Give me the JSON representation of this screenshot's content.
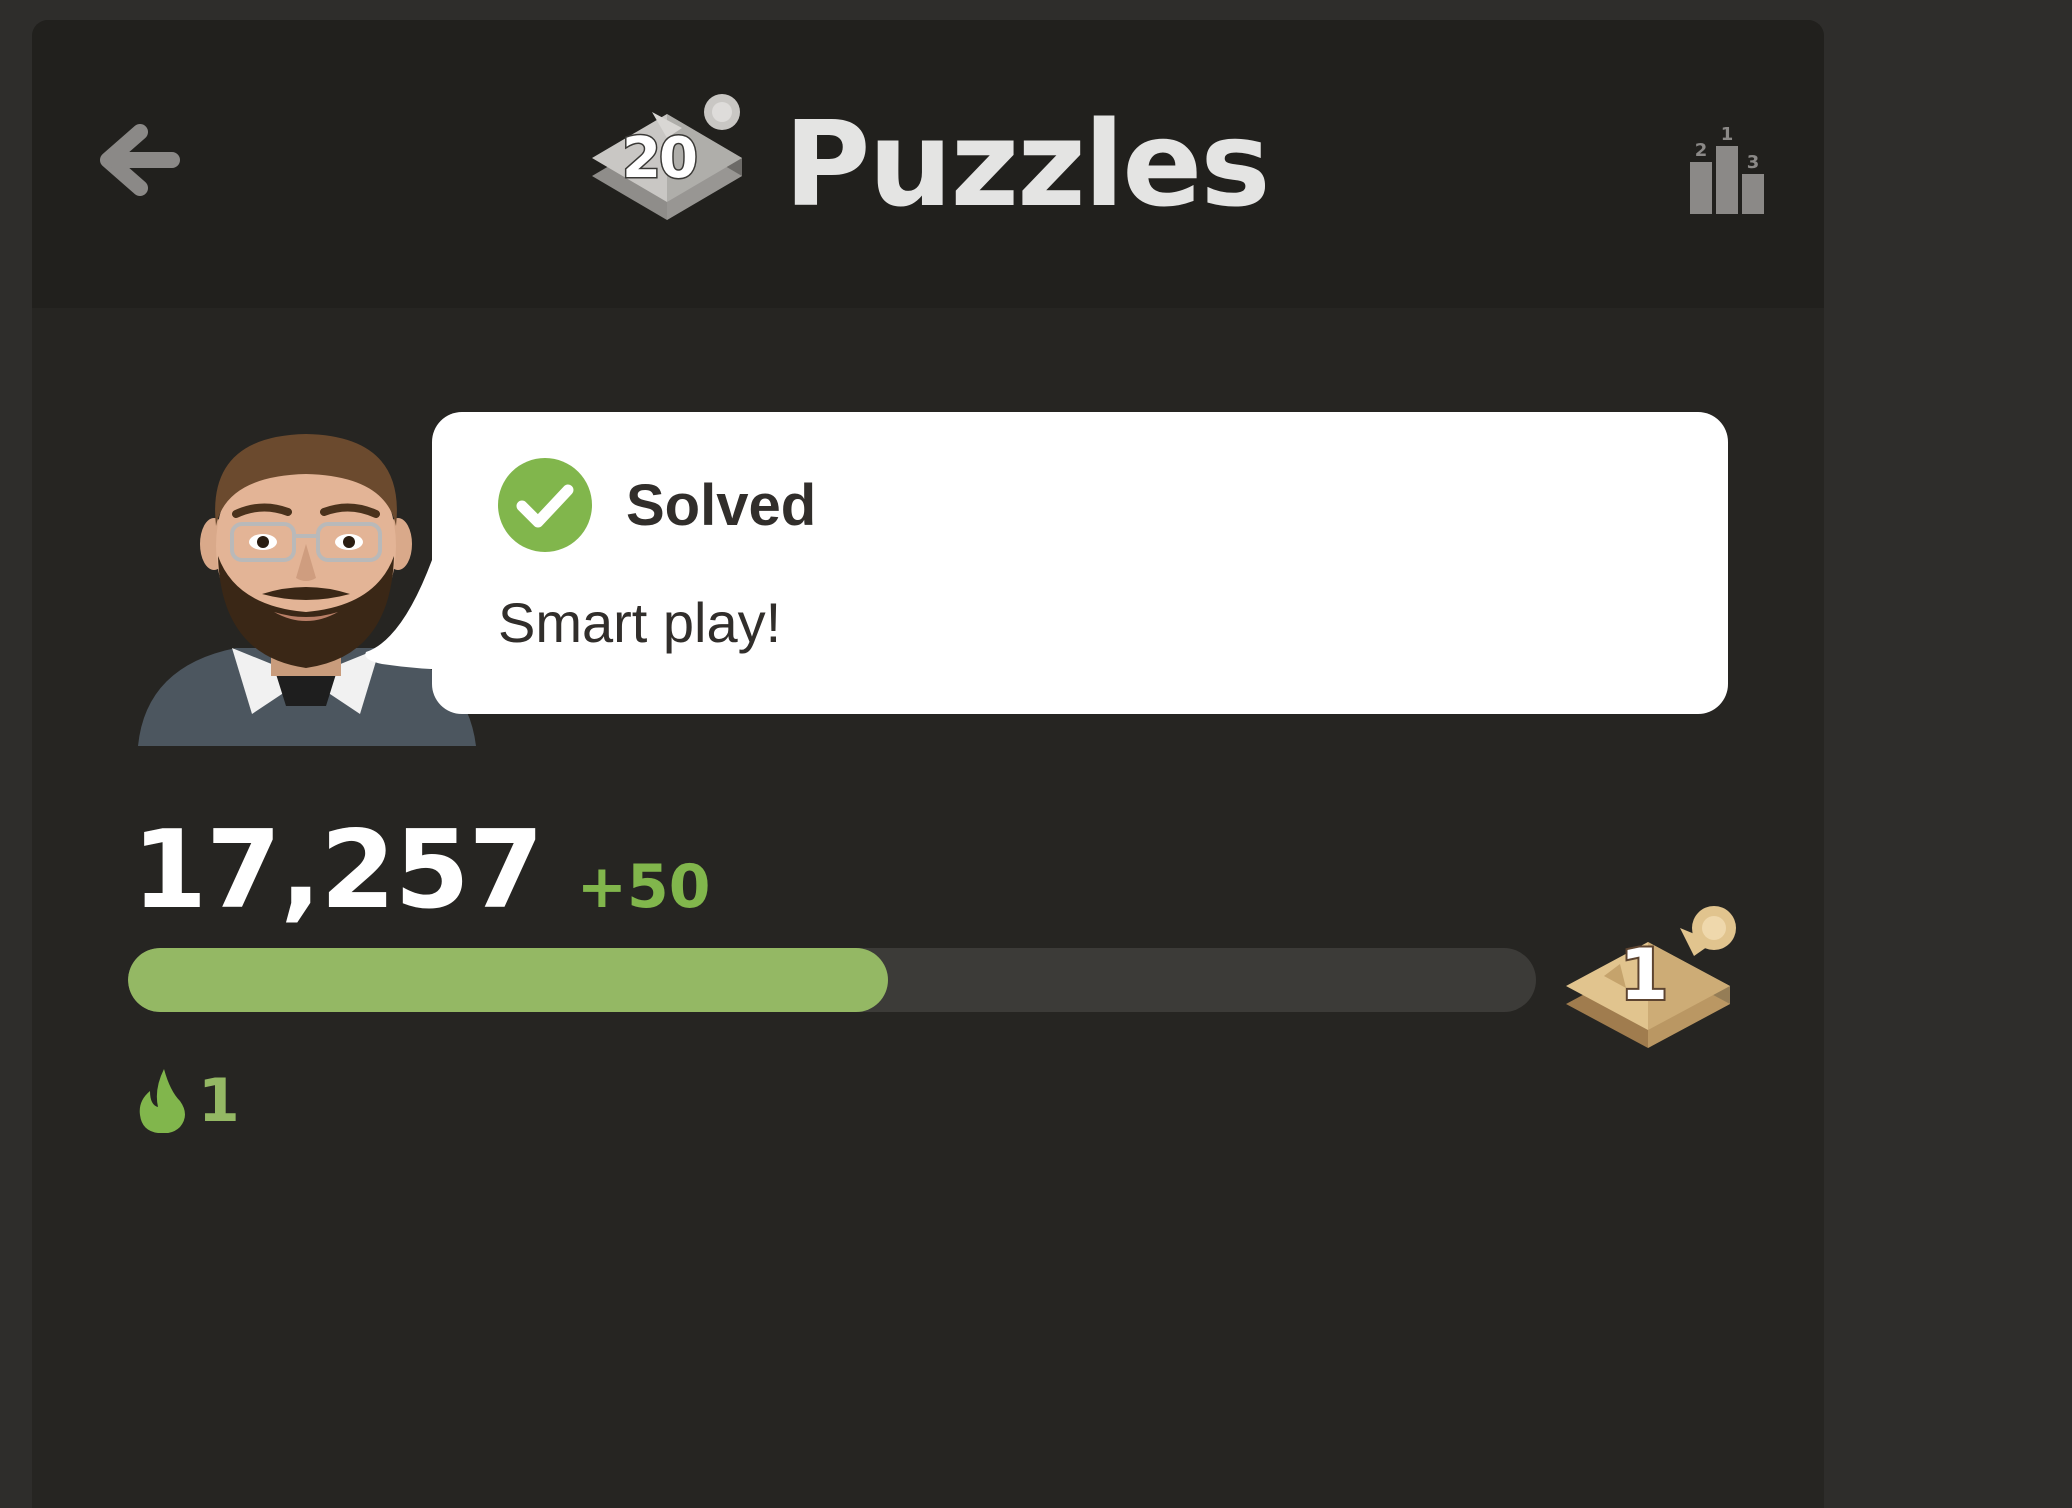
{
  "header": {
    "title": "Puzzles",
    "badge_count": "20",
    "back_icon": "arrow-left-icon",
    "leaderboard_icon": "podium-icon"
  },
  "feedback": {
    "status_label": "Solved",
    "status_icon": "check-circle-icon",
    "message": "Smart play!",
    "coach": "coach-avatar"
  },
  "rating": {
    "score": "17,257",
    "delta": "+50",
    "progress_fraction": 0.54,
    "level": "1",
    "streak_icon": "flame-icon",
    "streak_count": "1"
  },
  "colors": {
    "accent_green": "#81b64c",
    "bar_fill": "#94b864",
    "bar_track": "#3c3b38",
    "background": "#262522",
    "header_bg": "#21201d"
  }
}
